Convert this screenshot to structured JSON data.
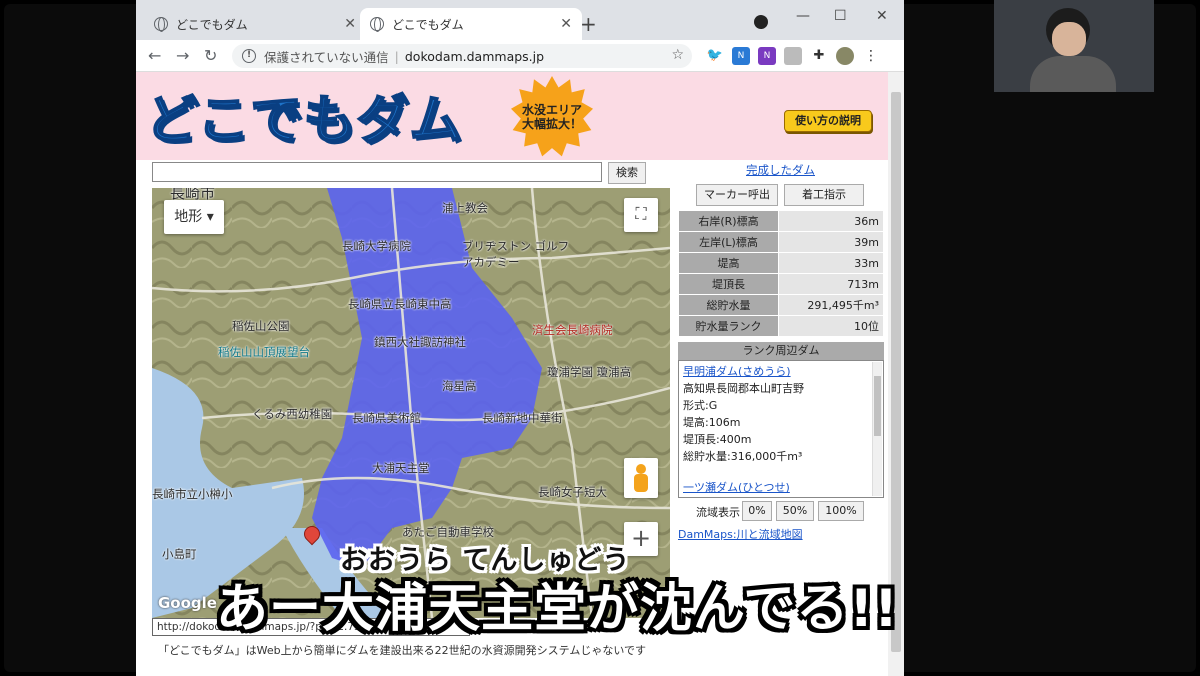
{
  "browser": {
    "tabs": [
      {
        "label": "どこでもダム"
      },
      {
        "label": "どこでもダム"
      }
    ],
    "address": {
      "security": "保護されていない通信",
      "url": "dokodam.dammaps.jp"
    }
  },
  "header": {
    "logo": "どこでもダム",
    "burst_line1": "水没エリア",
    "burst_line2": "大幅拡大！",
    "howto_label": "使い方の説明"
  },
  "search": {
    "button_label": "検索"
  },
  "map": {
    "maptype_label": "地形",
    "google_label": "Google",
    "labels": {
      "city": "長崎市",
      "church": "浦上教会",
      "hospital": "長崎大学病院",
      "golf": "ブリヂストン ゴルフアカデミー",
      "school1": "長崎県立長崎東中高",
      "park": "稲佐山公園",
      "saiseikai": "済生会長崎病院",
      "observatory": "稲佐山山頂展望台",
      "shrine": "鎮西大社諏訪神社",
      "kaisei": "海星高",
      "meiji": "瓊浦学園 瓊浦高",
      "kurumi": "くるみ西幼稚園",
      "museum": "長崎県美術館",
      "chinatown": "長崎新地中華街",
      "tenshudo": "大浦天主堂",
      "girls": "長崎女子短大",
      "kobiki": "長崎市立小榊小",
      "driving": "あたご自動車学校",
      "island": "小島町"
    },
    "url_value": "http://dokodam.dammaps.jp/?p=32.751"
  },
  "footer": {
    "text": "「どこでもダム」はWeb上から簡単にダムを建設出来る22世紀の水資源開発システムじゃないです"
  },
  "panel": {
    "complete_link": "完成したダム",
    "marker_button": "マーカー呼出",
    "start_button": "着工指示",
    "stats": [
      {
        "key": "右岸(R)標高",
        "value": "36m"
      },
      {
        "key": "左岸(L)標高",
        "value": "39m"
      },
      {
        "key": "堤高",
        "value": "33m"
      },
      {
        "key": "堤頂長",
        "value": "713m"
      },
      {
        "key": "総貯水量",
        "value": "291,495千m³"
      },
      {
        "key": "貯水量ランク",
        "value": "10位"
      }
    ],
    "rank_head": "ランク周辺ダム",
    "rank_dam": {
      "name": "早明浦ダム(さめうら)",
      "location": "高知県長岡郡本山町吉野",
      "type": "形式:G",
      "height": "堤高:106m",
      "length": "堤頂長:400m",
      "volume": "総貯水量:316,000千m³",
      "next": "一ツ瀬ダム(ひとつせ)"
    },
    "ratio_label": "流域表示",
    "ratio_buttons": [
      "0%",
      "50%",
      "100%"
    ],
    "dammaps_link": "DamMaps:川と流域地図"
  },
  "overlay": {
    "ruby": "おおうら てんしゅどう",
    "subtitle": "あー大浦天主堂が沈んでる!!"
  }
}
